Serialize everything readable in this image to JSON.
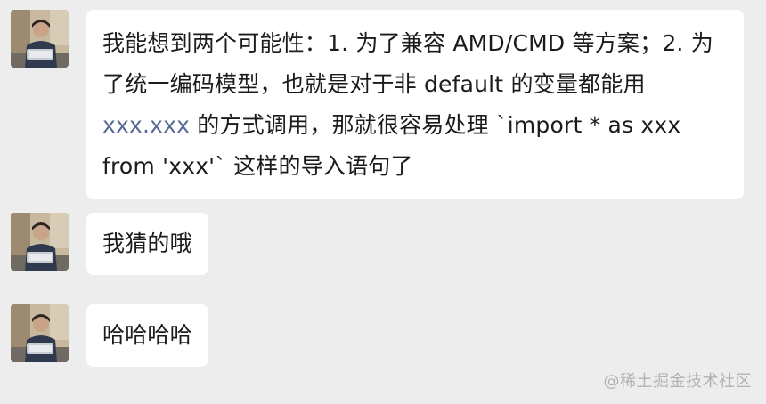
{
  "messages": [
    {
      "sender": "avatar",
      "part1": "我能想到两个可能性：1. 为了兼容 AMD/CMD 等方案；2. 为了统一编码模型，也就是对于非 default 的变量都能用 ",
      "link": "xxx.xxx",
      "part2": " 的方式调用，那就很容易处理 `import * as xxx from 'xxx'` 这样的导入语句了"
    },
    {
      "sender": "avatar",
      "text": "我猜的哦"
    },
    {
      "sender": "avatar",
      "text": "哈哈哈哈"
    }
  ],
  "watermark": "@稀土掘金技术社区",
  "colors": {
    "background": "#ededed",
    "bubble": "#ffffff",
    "link": "#576b95",
    "watermark": "#b2b2b2"
  }
}
